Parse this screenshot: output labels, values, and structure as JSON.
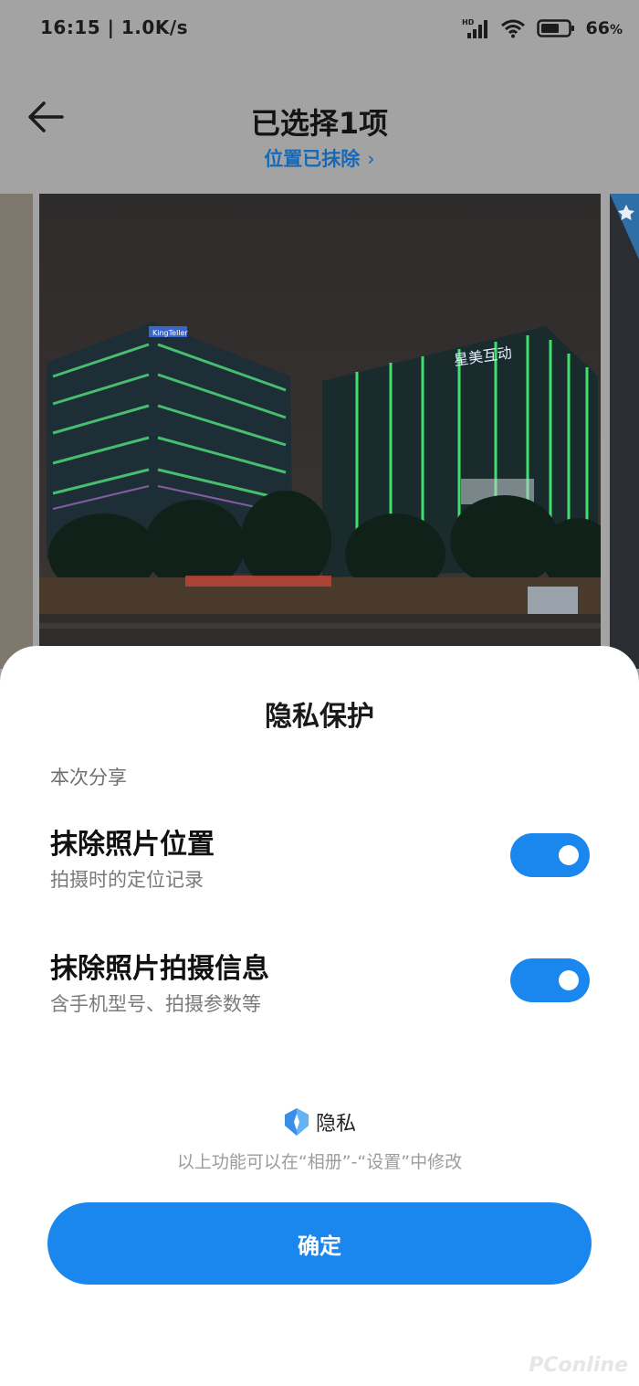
{
  "status": {
    "time": "16:15 | 1.0K/s",
    "battery_pct": "66",
    "pct_sign": "%",
    "network_badge": "HD"
  },
  "header": {
    "title": "已选择1项",
    "subtitle": "位置已抹除",
    "subtitle_chevron": "›"
  },
  "photo": {
    "sign_left": "KingTeller",
    "sign_right": "星美互动"
  },
  "sheet": {
    "title": "隐私保护",
    "section": "本次分享",
    "options": [
      {
        "title": "抹除照片位置",
        "subtitle": "拍摄时的定位记录",
        "enabled": true
      },
      {
        "title": "抹除照片拍摄信息",
        "subtitle": "含手机型号、拍摄参数等",
        "enabled": true
      }
    ],
    "privacy_label": "隐私",
    "note": "以上功能可以在“相册”-“设置”中修改",
    "confirm": "确定"
  },
  "watermark": "PConline",
  "colors": {
    "accent": "#1a87ee",
    "link": "#1869b6",
    "dim_overlay": "#a3a3a3"
  }
}
